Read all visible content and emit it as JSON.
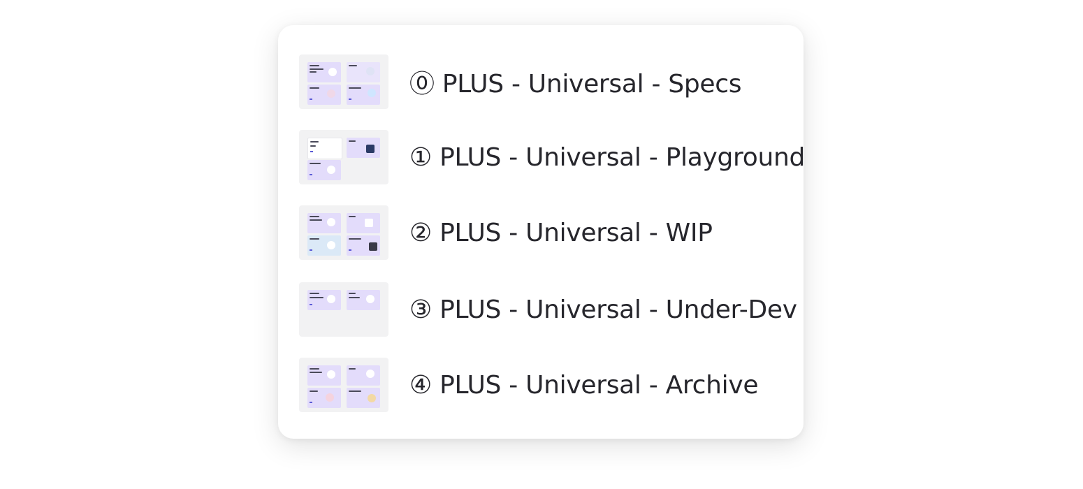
{
  "files": [
    {
      "label": "⓪ PLUS - Universal - Specs",
      "thumbnail_frames": 4
    },
    {
      "label": "① PLUS - Universal - Playground",
      "thumbnail_frames": 3
    },
    {
      "label": "② PLUS - Universal - WIP",
      "thumbnail_frames": 4
    },
    {
      "label": "③ PLUS - Universal - Under-Dev",
      "thumbnail_frames": 2
    },
    {
      "label": "④ PLUS - Universal - Archive",
      "thumbnail_frames": 4
    }
  ],
  "colors": {
    "card_background": "#ffffff",
    "thumbnail_background": "#f2f2f3",
    "frame_accent": "#e3dcfb",
    "label_text": "#26262c"
  }
}
